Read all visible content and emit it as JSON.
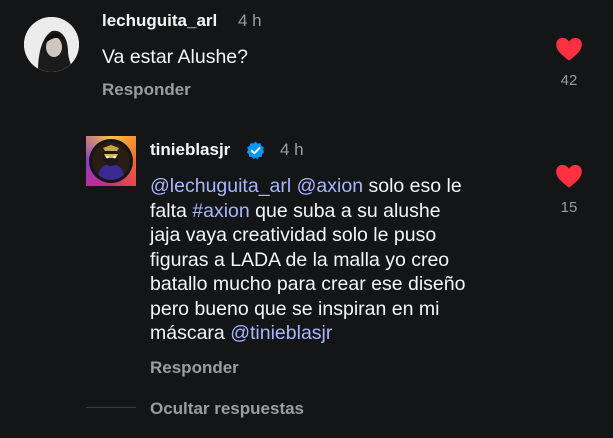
{
  "comments": [
    {
      "username": "lechuguita_arl",
      "time": "4 h",
      "text": "Va estar Alushe?",
      "reply_label": "Responder",
      "likes": "42"
    },
    {
      "username": "tinieblasjr",
      "verified": true,
      "time": "4 h",
      "mention1": "@lechuguita_arl",
      "mention2": "@axion",
      "text1": " solo eso le",
      "text2": "falta ",
      "hashtag": "#axion",
      "text3": " que suba a su alushe",
      "text4": "jaja vaya creatividad solo le puso",
      "text5": "figuras a LADA de la malla yo creo",
      "text6": "batallo mucho para crear ese diseño",
      "text7": "pero bueno que se inspiran en mi",
      "text8": "máscara ",
      "mention3": "@tinieblasjr",
      "reply_label": "Responder",
      "likes": "15"
    }
  ],
  "hide_replies_label": "Ocultar respuestas",
  "colors": {
    "background": "#141517",
    "like": "#ff3040",
    "mention": "#a7b6ff",
    "secondary_text": "#9a9ca0",
    "verified": "#0095f6"
  }
}
